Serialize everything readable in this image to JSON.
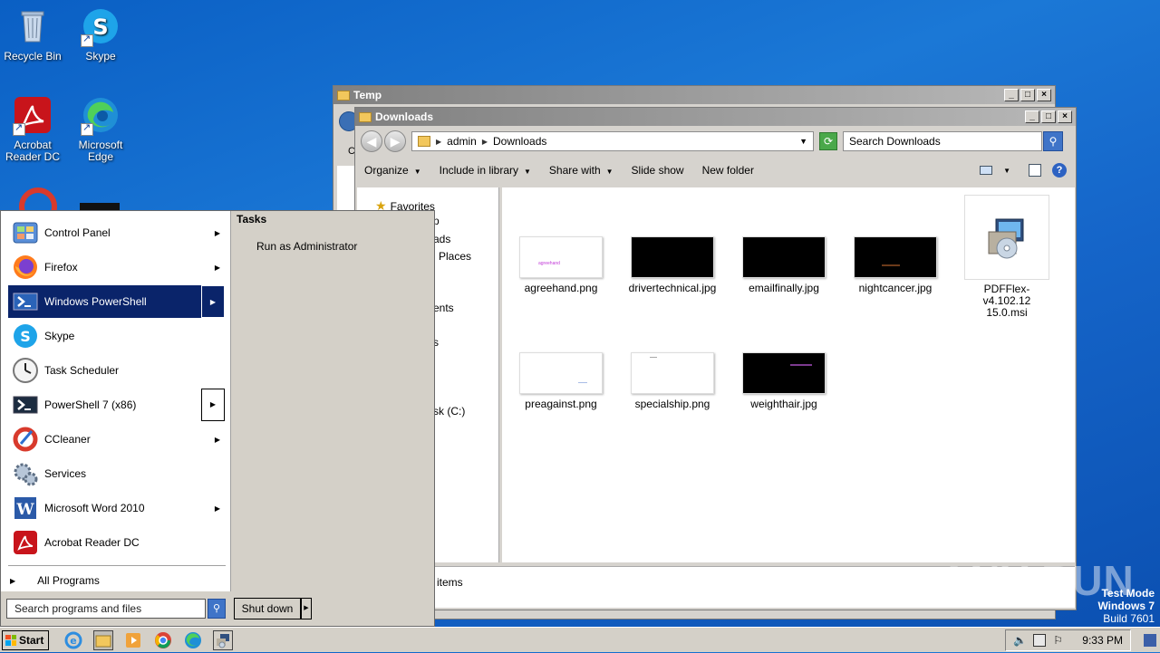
{
  "desktop": {
    "icons": [
      {
        "label": "Recycle Bin"
      },
      {
        "label": "Skype"
      },
      {
        "label": "Acrobat Reader DC"
      },
      {
        "label": "Microsoft Edge"
      }
    ]
  },
  "temp_window": {
    "title": "Temp",
    "partial_text": "C"
  },
  "downloads_window": {
    "title": "Downloads",
    "breadcrumb": [
      "admin",
      "Downloads"
    ],
    "search_placeholder": "Search Downloads",
    "toolbar": {
      "organize": "Organize",
      "include_in_library": "Include in library",
      "share_with": "Share with",
      "slide_show": "Slide show",
      "new_folder": "New folder"
    },
    "nav_pane": [
      "Favorites",
      "p",
      "ads",
      "Places",
      "ents",
      "s",
      "sk (C:)"
    ],
    "files": [
      {
        "name": "agreehand.png"
      },
      {
        "name": "drivertechnical.jpg"
      },
      {
        "name": "emailfinally.jpg"
      },
      {
        "name": "nightcancer.jpg"
      },
      {
        "name": "PDFFlex-v4.102.12 15.0.msi"
      },
      {
        "name": "preagainst.png"
      },
      {
        "name": "specialship.png"
      },
      {
        "name": "weighthair.jpg"
      }
    ],
    "status": "items"
  },
  "start_menu": {
    "programs": [
      {
        "label": "Control Panel"
      },
      {
        "label": "Firefox"
      },
      {
        "label": "Windows PowerShell"
      },
      {
        "label": "Skype"
      },
      {
        "label": "Task Scheduler"
      },
      {
        "label": "PowerShell 7 (x86)"
      },
      {
        "label": "CCleaner"
      },
      {
        "label": "Services"
      },
      {
        "label": "Microsoft Word 2010"
      },
      {
        "label": "Acrobat Reader DC"
      }
    ],
    "all_programs": "All Programs",
    "search_placeholder": "Search programs and files",
    "tasks_header": "Tasks",
    "tasks": [
      "Run as Administrator"
    ],
    "shutdown": "Shut down"
  },
  "taskbar": {
    "start_label": "Start",
    "clock": "9:33 PM"
  },
  "watermark": {
    "text": "ANY RUN"
  },
  "system_info": {
    "line1": "Test Mode",
    "line2": "Windows 7",
    "line3": "Build 7601"
  },
  "colors": {
    "selection": "#0a246a",
    "desktop": "#1565c9"
  }
}
